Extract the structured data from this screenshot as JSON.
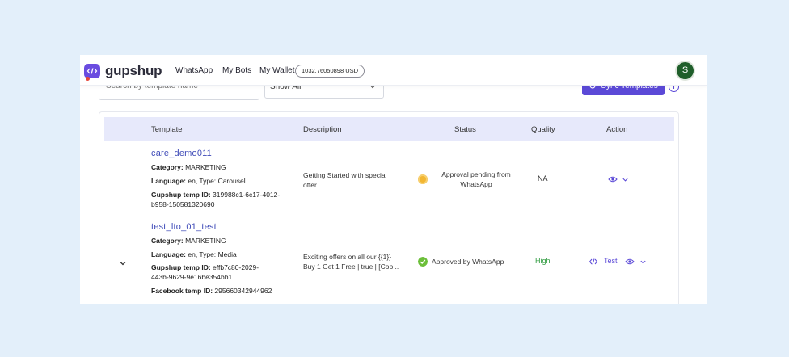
{
  "brand": {
    "name": "gupshup"
  },
  "nav": {
    "whatsapp": "WhatsApp",
    "my_bots": "My Bots",
    "my_wallet": "My Wallet",
    "wallet_balance": "1032.76050898 USD",
    "avatar_initial": "S"
  },
  "filters": {
    "search_placeholder": "Search by template name",
    "status_select": "Show All",
    "sync_button": "Sync Templates"
  },
  "table": {
    "headers": {
      "template": "Template",
      "description": "Description",
      "status": "Status",
      "quality": "Quality",
      "action": "Action"
    },
    "rows": [
      {
        "name": "care_demo011",
        "category_label": "Category:",
        "category": "MARKETING",
        "language_label": "Language:",
        "language": "en, Type:",
        "type": "Carousel",
        "gupshup_id_label": "Gupshup temp ID:",
        "gupshup_id_1": "319988c1-6c17-4012-",
        "gupshup_id_2": "b958-150581320690",
        "description_1": "Getting Started with special",
        "description_2": "offer",
        "status_1": "Approval pending from",
        "status_2": "WhatsApp",
        "status_color": "#f2b632",
        "quality": "NA",
        "quality_color": "#333333"
      },
      {
        "name": "test_lto_01_test",
        "category_label": "Category:",
        "category": "MARKETING",
        "language_label": "Language:",
        "language": "en, Type:",
        "type": "Media",
        "gupshup_id_label": "Gupshup temp ID:",
        "gupshup_id_1": "effb7c80-2029-",
        "gupshup_id_2": "443b-9629-9e16be354bb1",
        "facebook_id_label": "Facebook temp ID:",
        "facebook_id": "295660342944962",
        "description_1": "Exciting offers on all our {{1}}",
        "description_2": "Buy 1 Get 1 Free | true | [Cop...",
        "status_1": "Approved by WhatsApp",
        "status_color": "#6cbf3a",
        "quality": "High",
        "quality_color": "#2e9b3e",
        "test_action": "Test"
      }
    ]
  },
  "colors": {
    "accent": "#5b49d7",
    "link": "#3f4bb8",
    "header_bg": "#e7e9fb",
    "page_bg": "#e3effa"
  },
  "icons": [
    "gupshup-logo-icon",
    "sync-icon",
    "info-icon",
    "eye-icon",
    "chevron-down-icon",
    "code-icon",
    "status-pending-icon",
    "status-approved-icon",
    "cursor-icon"
  ]
}
